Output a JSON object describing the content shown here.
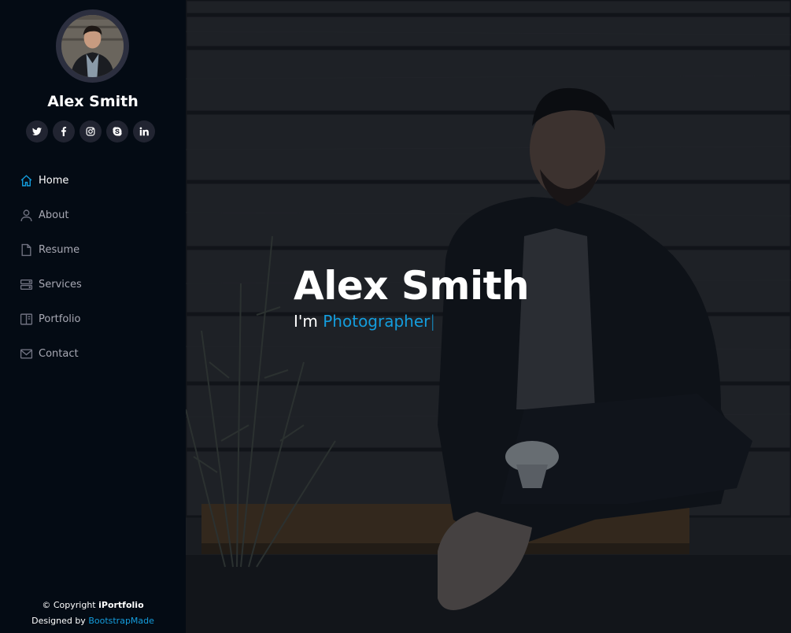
{
  "profile": {
    "name": "Alex Smith"
  },
  "social": [
    {
      "name": "twitter-icon"
    },
    {
      "name": "facebook-icon"
    },
    {
      "name": "instagram-icon"
    },
    {
      "name": "skype-icon"
    },
    {
      "name": "linkedin-icon"
    }
  ],
  "nav": {
    "items": [
      {
        "label": "Home",
        "icon": "home-icon",
        "active": true
      },
      {
        "label": "About",
        "icon": "person-icon"
      },
      {
        "label": "Resume",
        "icon": "file-icon"
      },
      {
        "label": "Services",
        "icon": "server-icon"
      },
      {
        "label": "Portfolio",
        "icon": "book-icon"
      },
      {
        "label": "Contact",
        "icon": "envelope-icon"
      }
    ]
  },
  "footer": {
    "copyright_prefix": "© Copyright ",
    "brand": "iPortfolio",
    "designed_prefix": "Designed by ",
    "designer": "BootstrapMade"
  },
  "hero": {
    "title": "Alex Smith",
    "subtitle_prefix": "I'm ",
    "typed": "Photographer",
    "cursor": "|"
  },
  "colors": {
    "accent": "#149ddd",
    "sidebar_bg": "#040b14",
    "social_bg": "#212431",
    "nav_text": "#a8a9b4"
  }
}
